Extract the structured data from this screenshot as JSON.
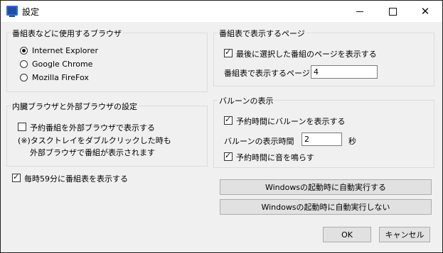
{
  "window": {
    "title": "設定",
    "minimize_glyph": "minimize-icon",
    "maximize_glyph": "maximize-icon",
    "close_label": "✕"
  },
  "browser_group": {
    "title": "番組表などに使用するブラウザ",
    "options": [
      {
        "label": "Internet Explorer",
        "selected": true
      },
      {
        "label": "Google Chrome",
        "selected": false
      },
      {
        "label": "Mozilla FireFox",
        "selected": false
      }
    ]
  },
  "internal_external_group": {
    "title": "内臓ブラウザと外部ブラウザの設定",
    "checkbox_label": "予約番組を外部ブラウザで表示する",
    "checked": false,
    "note_line1": "(※)タスクトレイをダブルクリックした時も",
    "note_line2": "外部ブラウザで番組が表示されます"
  },
  "hourly_checkbox": {
    "label": "毎時59分に番組表を表示する",
    "checked": true
  },
  "page_group": {
    "title": "番組表で表示するページ",
    "checkbox_label": "最後に選択した番組のページを表示する",
    "checked": true,
    "field_label": "番組表で表示するページ",
    "field_value": "4"
  },
  "balloon_group": {
    "title": "バルーンの表示",
    "show_checkbox_label": "予約時間にバルーンを表示する",
    "show_checked": true,
    "time_label": "バルーンの表示時間",
    "time_value": "2",
    "time_unit": "秒",
    "sound_checkbox_label": "予約時間に音を鳴らす",
    "sound_checked": true
  },
  "buttons": {
    "autorun_on": "Windowsの起動時に自動実行する",
    "autorun_off": "Windowsの起動時に自動実行しない",
    "ok": "OK",
    "cancel": "キャンセル"
  }
}
